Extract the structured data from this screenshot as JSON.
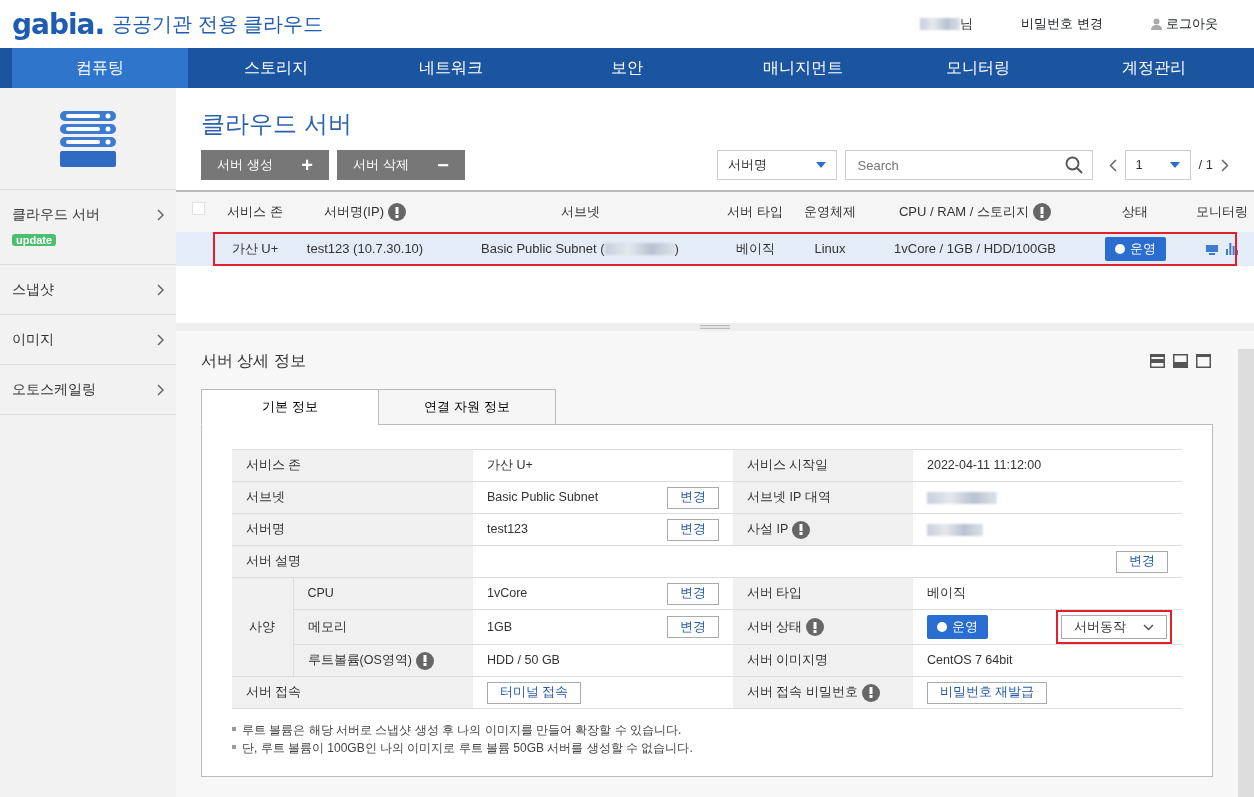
{
  "header": {
    "logo": "gabia.",
    "service_title": "공공기관 전용 클라우드",
    "user_suffix": "님",
    "links": [
      {
        "label": "비밀번호 변경",
        "icon": false
      },
      {
        "label": "로그아웃",
        "icon": true
      }
    ]
  },
  "nav": [
    {
      "label": "컴퓨팅",
      "selected": true
    },
    {
      "label": "스토리지",
      "selected": false
    },
    {
      "label": "네트워크",
      "selected": false
    },
    {
      "label": "보안",
      "selected": false
    },
    {
      "label": "매니지먼트",
      "selected": false
    },
    {
      "label": "모니터링",
      "selected": false
    },
    {
      "label": "계정관리",
      "selected": false
    }
  ],
  "sidebar": {
    "items": [
      {
        "label": "클라우드 서버",
        "badge": "update"
      },
      {
        "label": "스냅샷"
      },
      {
        "label": "이미지"
      },
      {
        "label": "오토스케일링"
      }
    ]
  },
  "page": {
    "title": "클라우드 서버",
    "buttons": [
      {
        "label": "서버 생성",
        "symbol": "+"
      },
      {
        "label": "서버 삭제",
        "symbol": "−"
      }
    ],
    "search": {
      "select": "서버명",
      "placeholder": "Search"
    },
    "pagination": {
      "page": "1",
      "total": "/ 1"
    }
  },
  "table": {
    "select_all": {
      "checked": false
    },
    "columns": [
      {
        "label": "서비스 존",
        "info": false
      },
      {
        "label": "서버명(IP)",
        "info": true
      },
      {
        "label": "서브넷",
        "info": false
      },
      {
        "label": "서버 타입",
        "info": false
      },
      {
        "label": "운영체제",
        "info": false
      },
      {
        "label": "CPU / RAM / 스토리지",
        "info": true
      },
      {
        "label": "상태",
        "info": false
      },
      {
        "label": "모니터링",
        "info": false
      }
    ],
    "rows": [
      {
        "zone": "가산 U+",
        "name": "test123 (10.7.30.10)",
        "subnet": "Basic Public Subnet (",
        "subnet_end": ")",
        "type": "베이직",
        "os": "Linux",
        "spec": "1vCore / 1GB / HDD/100GB",
        "status": "운영",
        "selected": true,
        "highlighted": true
      }
    ]
  },
  "detail": {
    "title": "서버 상세 정보",
    "tabs": [
      {
        "label": "기본 정보",
        "selected": true
      },
      {
        "label": "연결 자원 정보",
        "selected": false
      }
    ],
    "rows": [
      {
        "label": "서비스 존",
        "value": "가산 U+",
        "label2": "서비스 시작일",
        "value2": "2022-04-11 11:12:00"
      },
      {
        "label": "서브넷",
        "value": "Basic Public Subnet",
        "button": "변경",
        "label2": "서브넷 IP 대역",
        "redacted2": true
      },
      {
        "label": "서버명",
        "value": "test123",
        "button": "변경",
        "label2": "사설 IP",
        "info2": true,
        "redacted2": true
      },
      {
        "label": "서버 설명",
        "button": "변경"
      },
      {
        "group": "사양",
        "children": [
          {
            "label": "CPU",
            "value": "1vCore",
            "button": "변경",
            "label2": "서버 타입",
            "value2": "베이직"
          },
          {
            "label": "메모리",
            "value": "1GB",
            "button": "변경",
            "label2": "서버 상태",
            "info2": true,
            "status2": "운영",
            "dropdown2": {
              "label": "서버동작",
              "highlighted": true
            }
          },
          {
            "label": "루트볼륨(OS영역)",
            "info": true,
            "value": "HDD / 50 GB",
            "label2": "서버 이미지명",
            "value2": "CentOS 7 64bit"
          }
        ]
      },
      {
        "label": "서버 접속",
        "value_button": "터미널 접속",
        "label2": "서버 접속 비밀번호",
        "info2": true,
        "value2_button": "비밀번호 재발급"
      }
    ],
    "notes": [
      "루트 볼륨은 해당 서버로 스냅샷 생성 후 나의 이미지를 만들어 확장할 수 있습니다.",
      "단, 루트 볼륨이 100GB인 나의 이미지로 루트 볼륨 50GB 서버를 생성할 수 없습니다."
    ]
  }
}
